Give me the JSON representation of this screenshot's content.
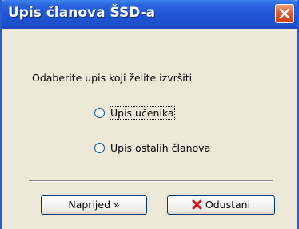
{
  "window": {
    "title": "Upis članova ŠSD-a"
  },
  "dialog": {
    "prompt": "Odaberite upis koji želite izvršiti",
    "options": [
      {
        "label": "Upis učenika",
        "selected": false,
        "focused": true
      },
      {
        "label": "Upis ostalih članova",
        "selected": false,
        "focused": false
      }
    ]
  },
  "buttons": {
    "next_label": "Naprijed »",
    "cancel_label": "Odustani"
  },
  "icons": {
    "close": "close-icon",
    "cancel": "red-x-icon"
  },
  "colors": {
    "titlebar": "#2a63dc",
    "close_button": "#e35a2e",
    "dialog_bg": "#ece9d8",
    "cancel_icon": "#d21414"
  }
}
